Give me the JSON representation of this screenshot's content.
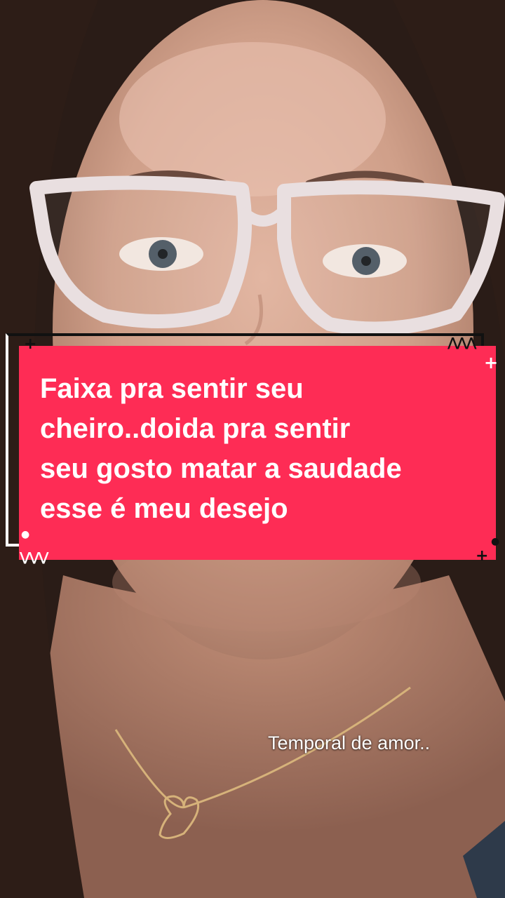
{
  "overlay": {
    "line1": "Faixa pra sentir seu",
    "line2": "cheiro..doida pra sentir",
    "line3": "seu gosto matar a saudade",
    "line4": "esse é meu desejo"
  },
  "caption": "Temporal de amor..",
  "colors": {
    "banner": "#fe2c55",
    "frame": "#ffffff",
    "text": "#ffffff"
  }
}
